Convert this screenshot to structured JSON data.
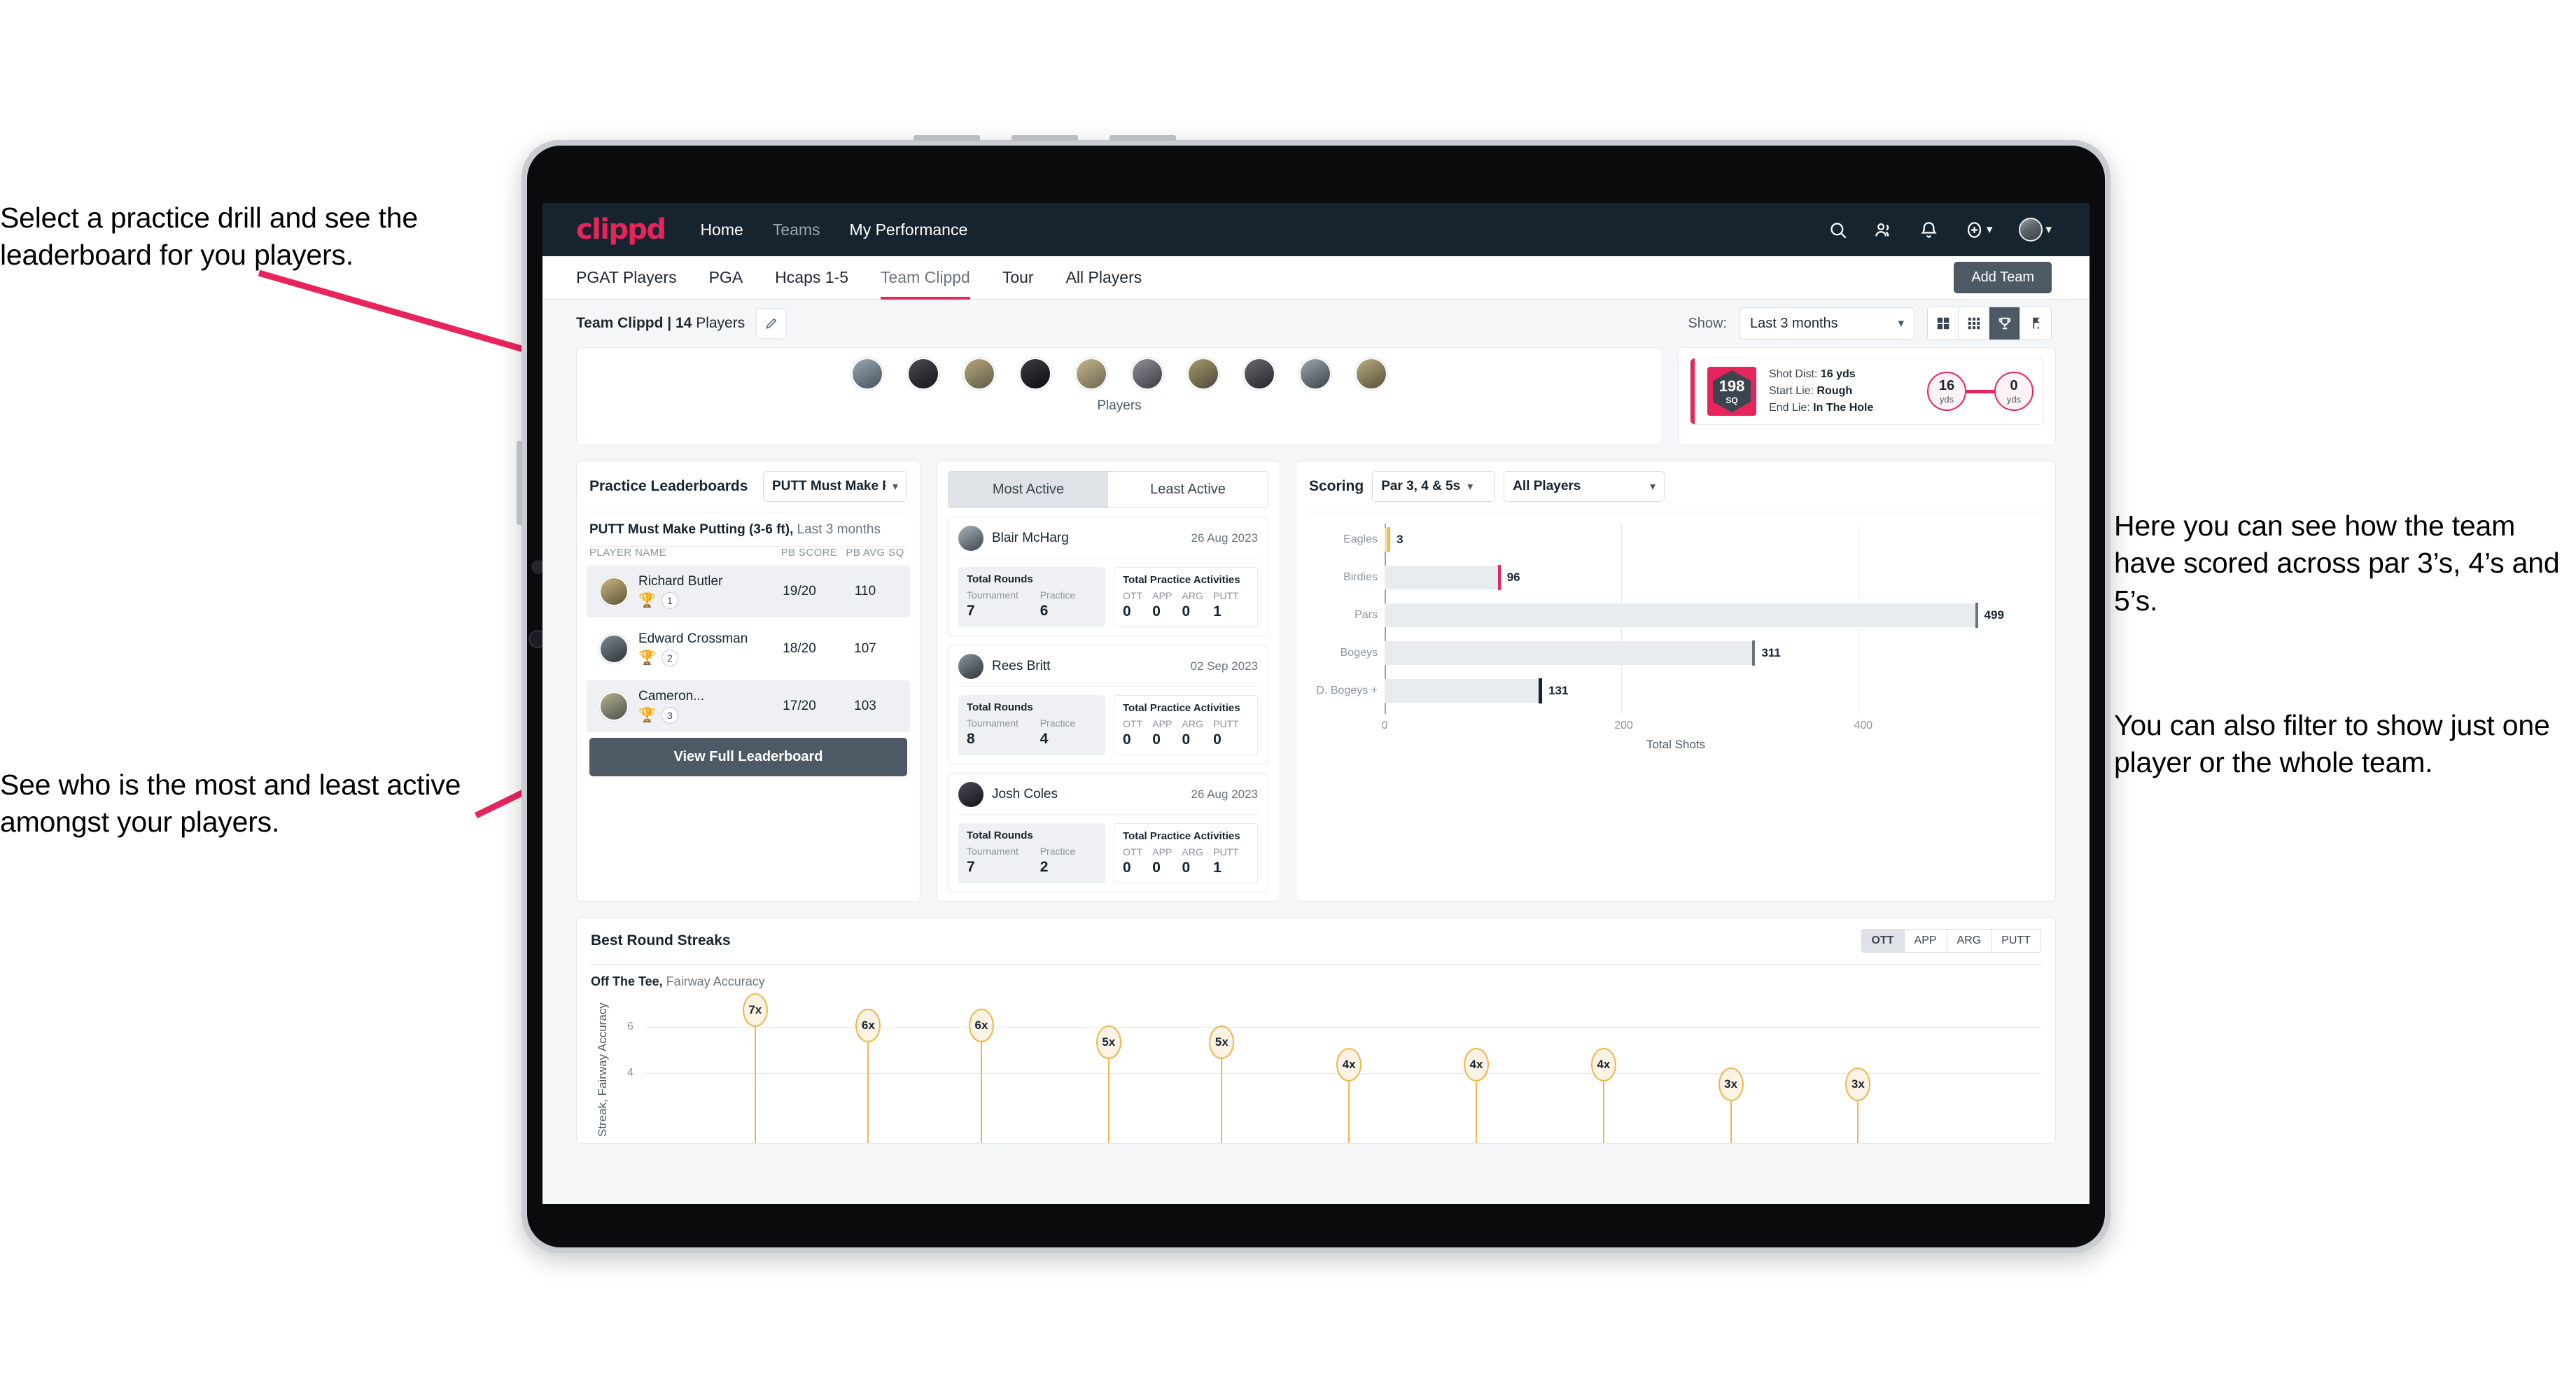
{
  "annotations": {
    "drill": "Select a practice drill and see the leaderboard for you players.",
    "active": "See who is the most and least active amongst your players.",
    "scoring": "Here you can see how the team have scored across par 3’s, 4’s and 5’s.",
    "filter": "You can also filter to show just one player or the whole team."
  },
  "topnav": {
    "logo": "clippd",
    "links": [
      {
        "label": "Home",
        "dim": false
      },
      {
        "label": "Teams",
        "dim": true
      },
      {
        "label": "My Performance",
        "dim": false
      }
    ],
    "icons": [
      "search-icon",
      "people-icon",
      "bell-icon",
      "plus-circle-icon"
    ],
    "avatar": "user-avatar"
  },
  "subtabs": {
    "items": [
      {
        "label": "PGAT Players",
        "active": false
      },
      {
        "label": "PGA",
        "active": false
      },
      {
        "label": "Hcaps 1-5",
        "active": false
      },
      {
        "label": "Team Clippd",
        "active": true
      },
      {
        "label": "Tour",
        "active": false
      },
      {
        "label": "All Players",
        "active": false
      }
    ],
    "add_team_label": "Add Team"
  },
  "toolbar": {
    "team_name": "Team Clippd | 14",
    "team_suffix": " Players",
    "show_label": "Show:",
    "show_value": "Last 3 months",
    "view_toggles": [
      {
        "icon": "grid-large-icon",
        "on": false
      },
      {
        "icon": "grid-small-icon",
        "on": false
      },
      {
        "icon": "trophy-icon",
        "on": true
      },
      {
        "icon": "golf-flag-icon",
        "on": false
      }
    ]
  },
  "players_strip": {
    "caption": "Players",
    "count": 10
  },
  "shot_card": {
    "sq_value": "198",
    "sq_label": "SQ",
    "lines": [
      {
        "key": "Shot Dist: ",
        "value": "16 yds"
      },
      {
        "key": "Start Lie: ",
        "value": "Rough"
      },
      {
        "key": "End Lie: ",
        "value": "In The Hole"
      }
    ],
    "start_dist": {
      "value": "16",
      "unit": "yds"
    },
    "end_dist": {
      "value": "0",
      "unit": "yds"
    }
  },
  "leaderboard": {
    "title": "Practice Leaderboards",
    "select_value": "PUTT Must Make Putting ...",
    "subtitle_bold": "PUTT Must Make Putting (3-6 ft),",
    "subtitle_rest": " Last 3 months",
    "columns": [
      "PLAYER NAME",
      "PB SCORE",
      "PB AVG SQ"
    ],
    "rows": [
      {
        "name": "Richard Butler",
        "trophy": "🏆",
        "trophy_color": "#e8b93a",
        "rank": "1",
        "score": "19/20",
        "sq": "110",
        "alt": true
      },
      {
        "name": "Edward Crossman",
        "trophy": "🏆",
        "trophy_color": "#b8bec4",
        "rank": "2",
        "score": "18/20",
        "sq": "107",
        "alt": false
      },
      {
        "name": "Cameron...",
        "trophy": "🏆",
        "trophy_color": "#c87b3a",
        "rank": "3",
        "score": "17/20",
        "sq": "103",
        "alt": true
      }
    ],
    "button_label": "View Full Leaderboard"
  },
  "activity": {
    "tabs": [
      {
        "label": "Most Active",
        "on": true
      },
      {
        "label": "Least Active",
        "on": false
      }
    ],
    "rounds_title": "Total Rounds",
    "acts_title": "Total Practice Activities",
    "rounds_cols": [
      "Tournament",
      "Practice"
    ],
    "acts_cols": [
      "OTT",
      "APP",
      "ARG",
      "PUTT"
    ],
    "items": [
      {
        "name": "Blair McHarg",
        "date": "26 Aug 2023",
        "tournament": "7",
        "practice": "6",
        "ott": "0",
        "app": "0",
        "arg": "0",
        "putt": "1"
      },
      {
        "name": "Rees Britt",
        "date": "02 Sep 2023",
        "tournament": "8",
        "practice": "4",
        "ott": "0",
        "app": "0",
        "arg": "0",
        "putt": "0"
      },
      {
        "name": "Josh Coles",
        "date": "26 Aug 2023",
        "tournament": "7",
        "practice": "2",
        "ott": "0",
        "app": "0",
        "arg": "0",
        "putt": "1"
      }
    ]
  },
  "scoring": {
    "title": "Scoring",
    "par_select": "Par 3, 4 & 5s",
    "player_select": "All Players"
  },
  "streaks": {
    "title": "Best Round Streaks",
    "segments": [
      {
        "label": "OTT",
        "on": true
      },
      {
        "label": "APP",
        "on": false
      },
      {
        "label": "ARG",
        "on": false
      },
      {
        "label": "PUTT",
        "on": false
      }
    ],
    "sub_bold": "Off The Tee,",
    "sub_rest": " Fairway Accuracy"
  },
  "chart_data": [
    {
      "type": "bar",
      "orientation": "horizontal",
      "title": "Scoring",
      "categories": [
        "Eagles",
        "Birdies",
        "Pars",
        "Bogeys",
        "D. Bogeys +"
      ],
      "values": [
        3,
        96,
        499,
        311,
        131
      ],
      "cap_colors": [
        "#eeb64b",
        "#e8245c",
        "#6b747d",
        "#6b747d",
        "#16242f"
      ],
      "xlabel": "Total Shots",
      "ylabel": "",
      "xlim": [
        0,
        540
      ],
      "xticks": [
        0,
        200,
        400
      ],
      "grid": true,
      "legend": "none"
    },
    {
      "type": "scatter",
      "title": "Best Round Streaks",
      "subtitle": "Off The Tee, Fairway Accuracy",
      "ylabel": "Streak, Fairway Accuracy",
      "xlabel": "",
      "ylim": [
        0,
        8
      ],
      "yticks": [
        4,
        6
      ],
      "values": [
        7,
        6,
        6,
        5,
        5,
        4,
        4,
        4,
        3,
        3
      ],
      "labels": [
        "7x",
        "6x",
        "6x",
        "5x",
        "5x",
        "4x",
        "4x",
        "4x",
        "3x",
        "3x"
      ],
      "grid": true,
      "legend": "none"
    }
  ]
}
